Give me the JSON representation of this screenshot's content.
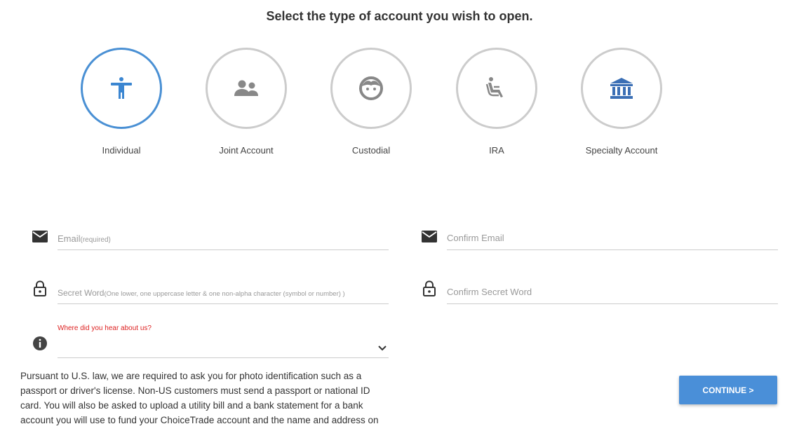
{
  "heading": "Select the type of account you wish to open.",
  "account_types": [
    {
      "label": "Individual",
      "icon": "person-icon",
      "selected": true
    },
    {
      "label": "Joint Account",
      "icon": "people-icon",
      "selected": false
    },
    {
      "label": "Custodial",
      "icon": "child-face-icon",
      "selected": false
    },
    {
      "label": "IRA",
      "icon": "seated-person-icon",
      "selected": false
    },
    {
      "label": "Specialty Account",
      "icon": "bank-icon",
      "selected": false
    }
  ],
  "form": {
    "email": {
      "placeholder": "Email",
      "hint": "(required)",
      "value": ""
    },
    "confirm_email": {
      "placeholder": "Confirm Email",
      "value": ""
    },
    "secret_word": {
      "placeholder": "Secret Word",
      "hint": "(One lower, one uppercase letter & one non-alpha character (symbol or number) )",
      "value": ""
    },
    "confirm_secret_word": {
      "placeholder": "Confirm Secret Word",
      "value": ""
    },
    "referral": {
      "label": "Where did you hear about us?",
      "value": ""
    }
  },
  "notice": "Pursuant to U.S. law, we are required to ask you for photo identification such as a passport or driver's license. Non-US customers must send a passport or national ID card. You will also be asked to upload a utility bill and a bank statement for a bank account you will use to fund your ChoiceTrade account and the name and address on",
  "continue_label": "CONTINUE >",
  "colors": {
    "accent": "#4a8fd8",
    "selected_ring": "#4a90d4",
    "unselected_ring": "#cccccc",
    "icon_gray": "#888888",
    "required_red": "#dd2222"
  }
}
